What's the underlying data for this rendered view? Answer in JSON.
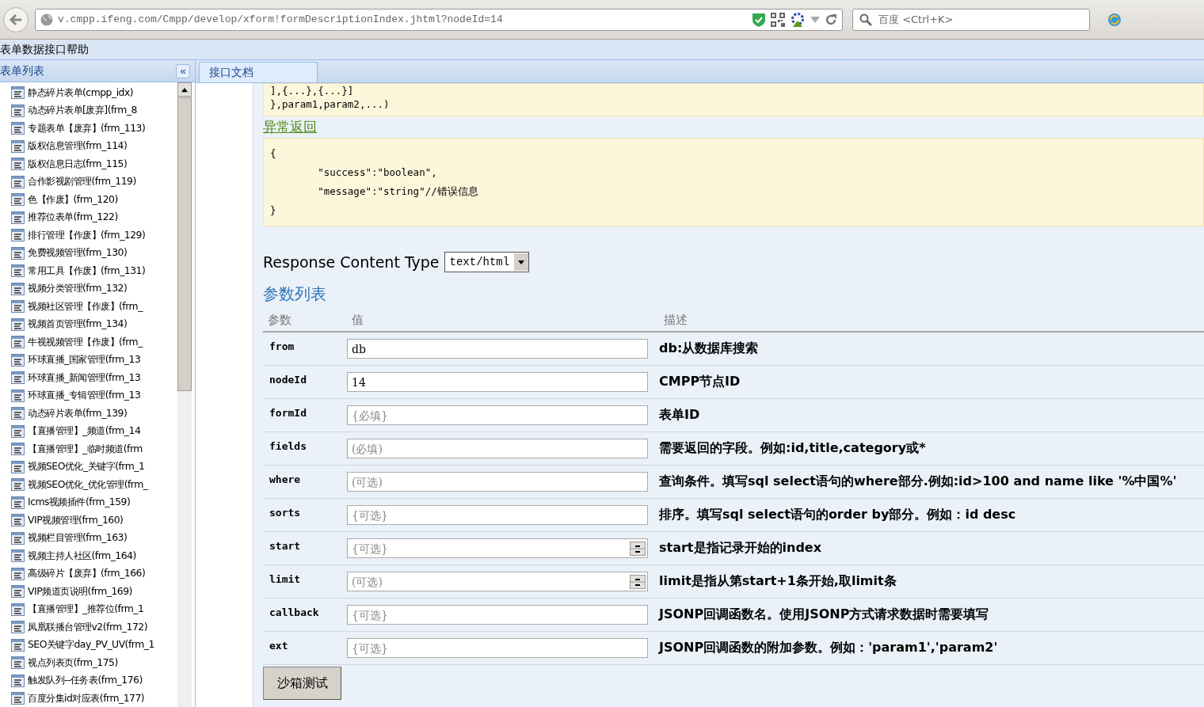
{
  "browser": {
    "url": "v.cmpp.ifeng.com/Cmpp/develop/xform!formDescriptionIndex.jhtml?nodeId=14",
    "search_placeholder": "百度 <Ctrl+K>"
  },
  "menu_bar": {
    "title": "表单数据接口帮助"
  },
  "sidebar": {
    "title": "表单列表",
    "collapse_label": "«",
    "items": [
      {
        "label": "静态碎片表单(cmpp_idx)"
      },
      {
        "label": "动态碎片表单[废弃](frm_8"
      },
      {
        "label": "专题表单【废弃】(frm_113)"
      },
      {
        "label": "版权信息管理(frm_114)"
      },
      {
        "label": "版权信息日志(frm_115)"
      },
      {
        "label": "合作影视剧管理(frm_119)"
      },
      {
        "label": "色【作废】(frm_120)"
      },
      {
        "label": "推荐位表单(frm_122)"
      },
      {
        "label": "排行管理【作废】(frm_129)"
      },
      {
        "label": "免费视频管理(frm_130)"
      },
      {
        "label": "常用工具【作废】(frm_131)"
      },
      {
        "label": "视频分类管理(frm_132)"
      },
      {
        "label": "视频社区管理【作废】(frm_"
      },
      {
        "label": "视频首页管理(frm_134)"
      },
      {
        "label": "牛视视频管理【作废】(frm_"
      },
      {
        "label": "环球直播_国家管理(frm_13"
      },
      {
        "label": "环球直播_新闻管理(frm_13"
      },
      {
        "label": "环球直播_专辑管理(frm_13"
      },
      {
        "label": "动态碎片表单(frm_139)"
      },
      {
        "label": "【直播管理】_频道(frm_14"
      },
      {
        "label": "【直播管理】_临时频道(frm"
      },
      {
        "label": "视频SEO优化_关键字(frm_1"
      },
      {
        "label": "视频SEO优化_优化管理(frm_"
      },
      {
        "label": "Icms视频插件(frm_159)"
      },
      {
        "label": "VIP视频管理(frm_160)"
      },
      {
        "label": "视频栏目管理(frm_163)"
      },
      {
        "label": "视频主持人社区(frm_164)"
      },
      {
        "label": "高级碎片【废弃】(frm_166)"
      },
      {
        "label": "VIP频道页说明(frm_169)"
      },
      {
        "label": "【直播管理】_推荐位(frm_1"
      },
      {
        "label": "凤凰联播台管理v2(frm_172)"
      },
      {
        "label": "SEO关键字day_PV_UV(frm_1"
      },
      {
        "label": "视点列表页(frm_175)"
      },
      {
        "label": "触发队列--任务表(frm_176)"
      },
      {
        "label": "百度分集id对应表(frm_177)"
      }
    ]
  },
  "tabs": [
    {
      "label": "接口文档",
      "selected": true
    }
  ],
  "doc": {
    "code_top": [
      "],{...},{...}]",
      "},param1,param2,...)"
    ],
    "error_heading": "异常返回",
    "error_code": [
      "{",
      "        \"success\":\"boolean\",",
      "        \"message\":\"string\"//错误信息",
      "}"
    ],
    "response_label": "Response Content Type",
    "response_value": "text/html",
    "params_heading": "参数列表",
    "columns": [
      "参数",
      "值",
      "描述"
    ],
    "params": [
      {
        "name": "from",
        "kind": "text",
        "value": "db",
        "description": "db:从数据库搜索"
      },
      {
        "name": "nodeId",
        "kind": "text",
        "value": "14",
        "description": "CMPP节点ID"
      },
      {
        "name": "formId",
        "kind": "text",
        "placeholder": "{必填}",
        "description": "表单ID"
      },
      {
        "name": "fields",
        "kind": "text",
        "placeholder": "(必填)",
        "description": "需要返回的字段。例如:id,title,category或*"
      },
      {
        "name": "where",
        "kind": "text",
        "placeholder": "(可选)",
        "description": "查询条件。填写sql select语句的where部分.例如:id>100 and name like '%中国%'"
      },
      {
        "name": "sorts",
        "kind": "text",
        "placeholder": "{可选}",
        "description": "排序。填写sql select语句的order by部分。例如：id desc"
      },
      {
        "name": "start",
        "kind": "number",
        "placeholder": "{可选}",
        "description": "start是指记录开始的index"
      },
      {
        "name": "limit",
        "kind": "number",
        "placeholder": "(可选)",
        "description": "limit是指从第start+1条开始,取limit条"
      },
      {
        "name": "callback",
        "kind": "text",
        "placeholder": "{可选}",
        "description": "JSONP回调函数名。使用JSONP方式请求数据时需要填写"
      },
      {
        "name": "ext",
        "kind": "text",
        "placeholder": "{可选}",
        "description": "JSONP回调函数的附加参数。例如：'param1','param2'"
      }
    ],
    "submit": "沙箱测试"
  }
}
